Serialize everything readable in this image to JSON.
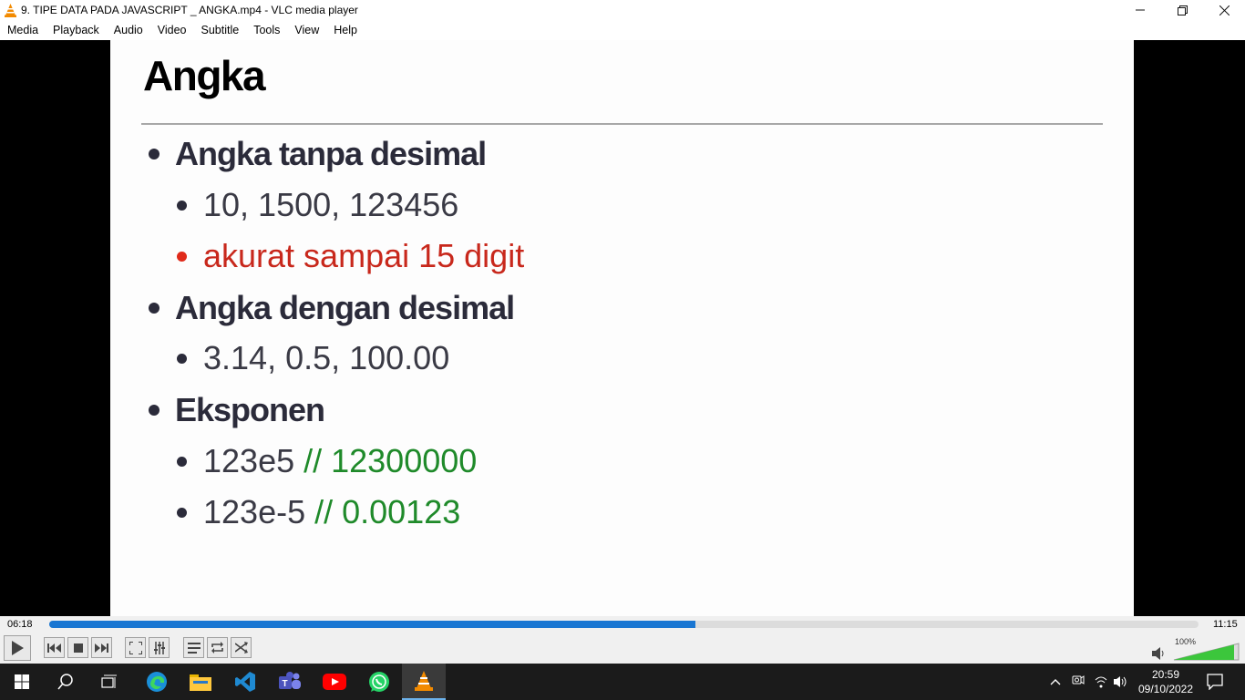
{
  "window": {
    "title": "9. TIPE DATA PADA JAVASCRIPT _ ANGKA.mp4 - VLC media player"
  },
  "menu": [
    "Media",
    "Playback",
    "Audio",
    "Video",
    "Subtitle",
    "Tools",
    "View",
    "Help"
  ],
  "slide": {
    "title": "Angka",
    "items": [
      {
        "level": 1,
        "text": "Angka tanpa desimal"
      },
      {
        "level": 2,
        "text": "10, 1500, 123456"
      },
      {
        "level": 2,
        "text": "akurat sampai 15 digit",
        "color": "#c8281c"
      },
      {
        "level": 1,
        "text": "Angka dengan desimal"
      },
      {
        "level": 2,
        "text": "3.14, 0.5, 100.00"
      },
      {
        "level": 1,
        "text": "Eksponen"
      },
      {
        "level": 2,
        "text": "123e5 ",
        "comment": "// 12300000"
      },
      {
        "level": 2,
        "text": "123e-5 ",
        "comment": "// 0.00123"
      }
    ]
  },
  "player": {
    "elapsed": "06:18",
    "total": "11:15",
    "progress_fraction": 0.562,
    "volume": "100%",
    "accent": "#1976d2"
  },
  "taskbar": {
    "time": "20:59",
    "date": "09/10/2022"
  }
}
